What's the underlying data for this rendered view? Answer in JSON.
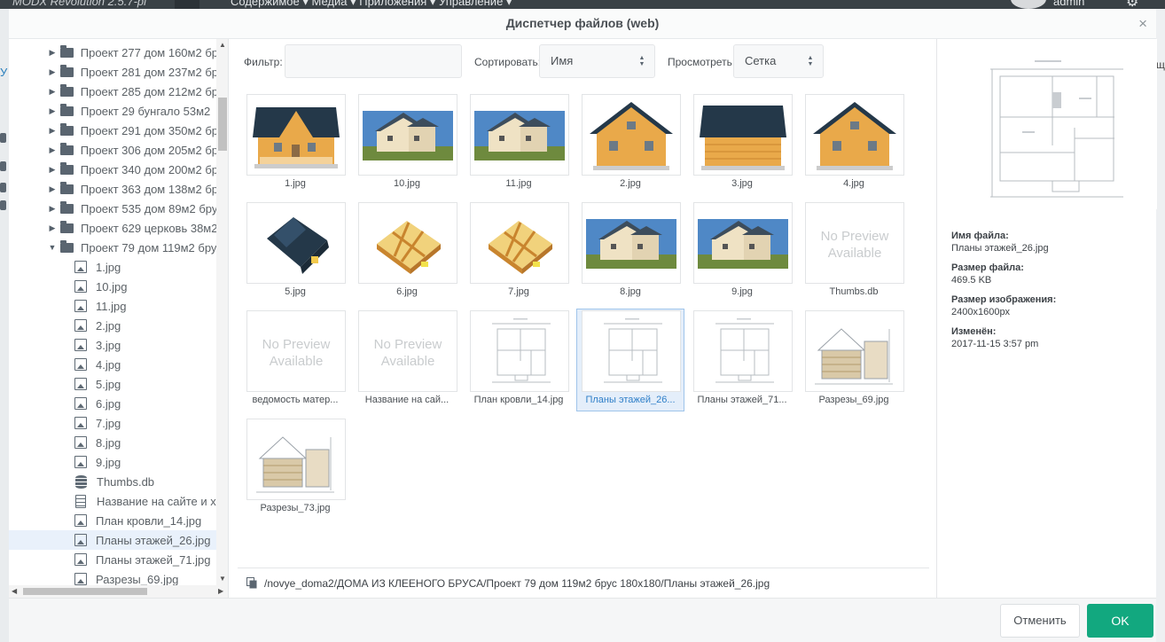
{
  "app": {
    "brand": "MODX Revolution 2.5.7-pl",
    "menu": "Содержимое ▾     Медиа ▾     Приложения ▾     Управление ▾",
    "user": "admin"
  },
  "modal": {
    "title": "Диспетчер файлов (web)",
    "close_glyph": "×"
  },
  "toolbar": {
    "filter_label": "Фильтр:",
    "filter_value": "",
    "sort_label": "Сортировать:",
    "sort_value": "Имя",
    "view_label": "Просмотреть:",
    "view_value": "Сетка"
  },
  "tree": {
    "items": [
      {
        "type": "folder",
        "label": "Проект 277 дом 160м2 бр"
      },
      {
        "type": "folder",
        "label": "Проект 281 дом 237м2 бр"
      },
      {
        "type": "folder",
        "label": "Проект 285 дом 212м2 бр"
      },
      {
        "type": "folder",
        "label": "Проект 29 бунгало 53м2"
      },
      {
        "type": "folder",
        "label": "Проект 291 дом 350м2 бр"
      },
      {
        "type": "folder",
        "label": "Проект 306 дом 205м2 бр"
      },
      {
        "type": "folder",
        "label": "Проект 340 дом 200м2 бр"
      },
      {
        "type": "folder",
        "label": "Проект 363 дом 138м2 бр"
      },
      {
        "type": "folder",
        "label": "Проект 535 дом 89м2 бру"
      },
      {
        "type": "folder",
        "label": "Проект 629 церковь 38м2"
      },
      {
        "type": "folder-open",
        "label": "Проект 79 дом 119м2 бру"
      },
      {
        "type": "image",
        "label": "1.jpg"
      },
      {
        "type": "image",
        "label": "10.jpg"
      },
      {
        "type": "image",
        "label": "11.jpg"
      },
      {
        "type": "image",
        "label": "2.jpg"
      },
      {
        "type": "image",
        "label": "3.jpg"
      },
      {
        "type": "image",
        "label": "4.jpg"
      },
      {
        "type": "image",
        "label": "5.jpg"
      },
      {
        "type": "image",
        "label": "6.jpg"
      },
      {
        "type": "image",
        "label": "7.jpg"
      },
      {
        "type": "image",
        "label": "8.jpg"
      },
      {
        "type": "image",
        "label": "9.jpg"
      },
      {
        "type": "db",
        "label": "Thumbs.db"
      },
      {
        "type": "doc",
        "label": "Название на сайте и х"
      },
      {
        "type": "image",
        "label": "План кровли_14.jpg"
      },
      {
        "type": "image",
        "label": "Планы этажей_26.jpg",
        "selected": true
      },
      {
        "type": "image",
        "label": "Планы этажей_71.jpg"
      },
      {
        "type": "image",
        "label": "Разрезы_69.jpg"
      }
    ]
  },
  "grid": {
    "no_preview_text": "No Preview Available",
    "files": [
      {
        "name": "1.jpg",
        "kind": "house-front"
      },
      {
        "name": "10.jpg",
        "kind": "house-photo"
      },
      {
        "name": "11.jpg",
        "kind": "house-photo"
      },
      {
        "name": "2.jpg",
        "kind": "house-gable"
      },
      {
        "name": "3.jpg",
        "kind": "house-side"
      },
      {
        "name": "4.jpg",
        "kind": "house-gable"
      },
      {
        "name": "5.jpg",
        "kind": "roof-3d"
      },
      {
        "name": "6.jpg",
        "kind": "floor-3d"
      },
      {
        "name": "7.jpg",
        "kind": "floor-3d"
      },
      {
        "name": "8.jpg",
        "kind": "house-photo"
      },
      {
        "name": "9.jpg",
        "kind": "house-photo"
      },
      {
        "name": "Thumbs.db",
        "kind": "no-preview"
      },
      {
        "name": "ведомость матер...",
        "kind": "no-preview"
      },
      {
        "name": "Название на сай...",
        "kind": "no-preview"
      },
      {
        "name": "План кровли_14.jpg",
        "kind": "plan"
      },
      {
        "name": "Планы этажей_26...",
        "kind": "plan",
        "selected": true
      },
      {
        "name": "Планы этажей_71...",
        "kind": "plan"
      },
      {
        "name": "Разрезы_69.jpg",
        "kind": "section"
      },
      {
        "name": "Разрезы_73.jpg",
        "kind": "section"
      }
    ]
  },
  "path": "/novye_doma2/ДОМА ИЗ КЛЕЕНОГО БРУСА/Проект 79 дом 119м2 брус 180х180/Планы этажей_26.jpg",
  "info": {
    "name_label": "Имя файла:",
    "name_value": "Планы этажей_26.jpg",
    "size_label": "Размер файла:",
    "size_value": "469.5 KB",
    "dims_label": "Размер изображения:",
    "dims_value": "2400x1600px",
    "modified_label": "Изменён:",
    "modified_value": "2017-11-15 3:57 pm"
  },
  "footer": {
    "cancel_label": "Отменить",
    "ok_label": "OK"
  },
  "colors": {
    "accent": "#12a87f",
    "selection": "#e4eefa",
    "selection_border": "#9fc4ea",
    "header_bar": "#3a4146"
  },
  "background_peek": {
    "left_letter": "У",
    "right_letter": "щ"
  }
}
